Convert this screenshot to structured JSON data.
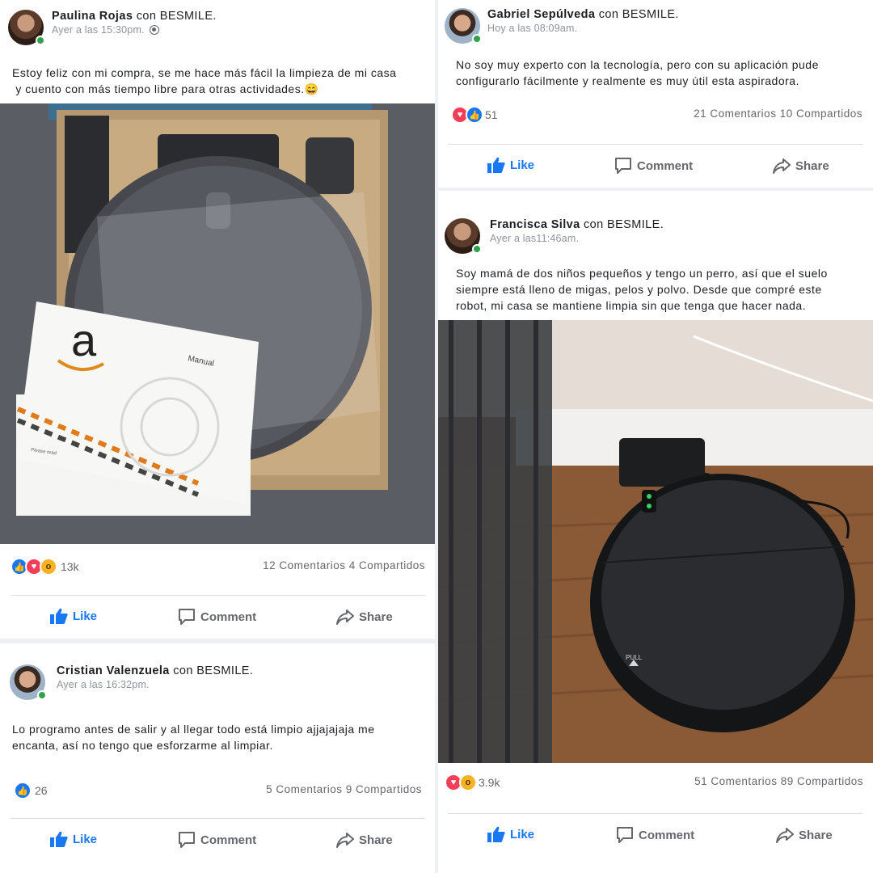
{
  "posts": {
    "paulina": {
      "name": "Paulina Rojas",
      "with": "con BESMILE.",
      "time": "Ayer a las 15:30pm.",
      "text_l1": "Estoy feliz con mi compra, se me hace más fácil la limpieza de mi casa",
      "text_l2": " y cuento con más tiempo libre para otras actividades.😄",
      "photo_brand": "a",
      "photo_manual": "Manual",
      "photo_caption": "Please read",
      "reactions_count": "13k",
      "comments_shares": "12 Comentarios 4 Compartidos"
    },
    "cristian": {
      "name": "Cristian Valenzuela",
      "with": "con BESMILE.",
      "time": "Ayer a las 16:32pm.",
      "text_l1": "Lo programo antes de salir y al llegar todo está limpio ajjajajaja me",
      "text_l2": "encanta, así no tengo que esforzarme al limpiar.",
      "reactions_count": "26",
      "comments_shares": "5 Comentarios 9 Compartidos"
    },
    "gabriel": {
      "name": "Gabriel Sepúlveda",
      "with": "con BESMILE.",
      "time": "Hoy a las 08:09am.",
      "text_l1": "No soy muy experto con la tecnología, pero con su aplicación pude",
      "text_l2": "configurarlo fácilmente y realmente es muy útil esta aspiradora.",
      "reactions_count": "51",
      "comments_shares": "21 Comentarios 10 Compartidos"
    },
    "francisca": {
      "name": "Francisca Silva",
      "with": "con BESMILE.",
      "time": "Ayer a las11:46am.",
      "text_l1": "Soy mamá de dos niños pequeños y tengo un perro, así que el suelo",
      "text_l2": "siempre está lleno de migas, pelos y polvo. Desde que compré este",
      "text_l3": "robot, mi casa se mantiene limpia sin que tenga que hacer nada.",
      "photo_label": "PULL",
      "reactions_count": "3.9k",
      "comments_shares": "51 Comentarios 89 Compartidos"
    }
  },
  "actions": {
    "like": "Like",
    "comment": "Comment",
    "share": "Share"
  },
  "colors": {
    "accent": "#1877f2",
    "love": "#f33e58",
    "online": "#31a24c"
  },
  "icons": [
    "globe-icon",
    "like-reaction-icon",
    "love-reaction-icon",
    "wow-reaction-icon",
    "thumbs-up-icon",
    "comment-icon",
    "share-icon"
  ]
}
